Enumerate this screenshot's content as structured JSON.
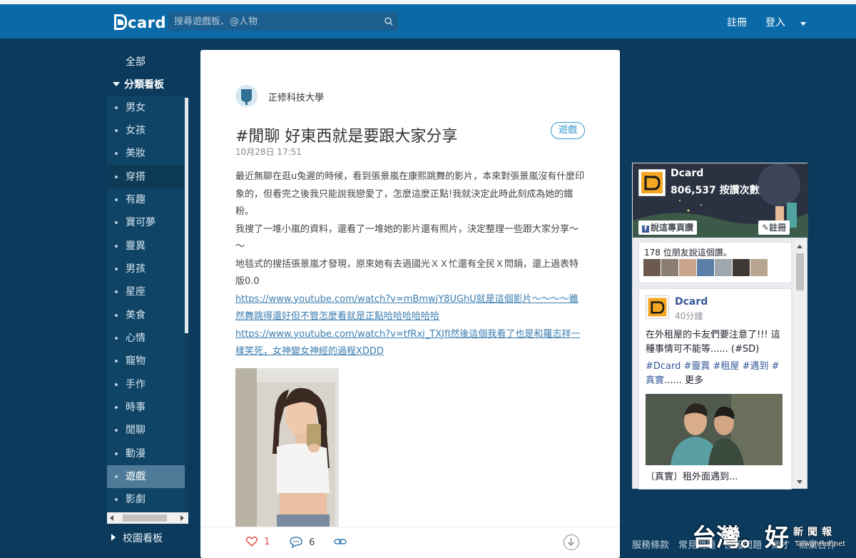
{
  "colors": {
    "topbar": "#0a6aa8",
    "background": "#0b3a5c",
    "sidebar_selected": "#4f7b99",
    "link": "#3a7db0",
    "tag": "#3397cf",
    "like": "#e34d4d"
  },
  "header": {
    "logo_text": "card",
    "search_placeholder": "搜尋遊戲板、@人物",
    "register": "註冊",
    "login": "登入"
  },
  "sidebar": {
    "all": "全部",
    "category_header": "分類看板",
    "items": [
      "男女",
      "女孩",
      "美妝",
      "穿搭",
      "有趣",
      "寶可夢",
      "靈異",
      "男孩",
      "星座",
      "美食",
      "心情",
      "寵物",
      "手作",
      "時事",
      "閒聊",
      "動漫",
      "遊戲",
      "影劇"
    ],
    "selected": "遊戲",
    "campus_header": "校園看板"
  },
  "post": {
    "school": "正修科技大學",
    "title": "#閒聊 好東西就是要跟大家分享",
    "tag": "遊戲",
    "date": "10月28日 17:51",
    "paragraph1": "最近無聊在逛u兔遲的時候，看到張景嵐在康熙跳舞的影片，本來對張景嵐沒有什麼印象的，但看完之後我只能說我戀愛了，怎麼這麼正點!我就決定此時此刻成為她的鐵粉。",
    "paragraph2": "我搜了一堆小嵐的資料，還看了一堆她的影片還有照片，決定整理一些跟大家分享～～",
    "paragraph3": "地毯式的搜括張景嵐才發現，原來她有去過國光ＸＸ忙還有全民Ｘ問鍋，還上過表特版0.0",
    "link1": "https://www.youtube.com/watch?v=mBmwjY8UGhU就是這個影片～～～～雖然舞跳得還好但不管怎麼看就是正點哈哈哈哈哈哈",
    "link2": "https://www.youtube.com/watch?v=tfRxj_TXJfI然後這個我看了也是和羅志祥一樣笑死，女神變女神經的過程XDDD",
    "likes": "1",
    "comments": "6"
  },
  "facebook": {
    "page_name": "Dcard",
    "likes_text": "806,537 按讚次數",
    "like_page_button": "說這專頁讚",
    "signup_button": "註冊",
    "friends_text": "178 位朋友說這個讚。",
    "post_name": "Dcard",
    "post_time": "40分鐘",
    "post_text": "在外租屋的卡友們要注意了!!! 這種事情可不能等...... (#SD)",
    "post_tags_1": "#Dcard #靈異 #租屋 #遇到 #",
    "post_tags_2": "真實",
    "post_tags_more": "...... 更多",
    "post_caption": "〔真實〕租外面遇到..."
  },
  "footer": {
    "terms": "服務條款　常見問題　回報問題　徵才　商業合作"
  },
  "watermark": {
    "main": "台灣。好",
    "sub": "新聞報",
    "url": "TaiwanHot.net"
  }
}
